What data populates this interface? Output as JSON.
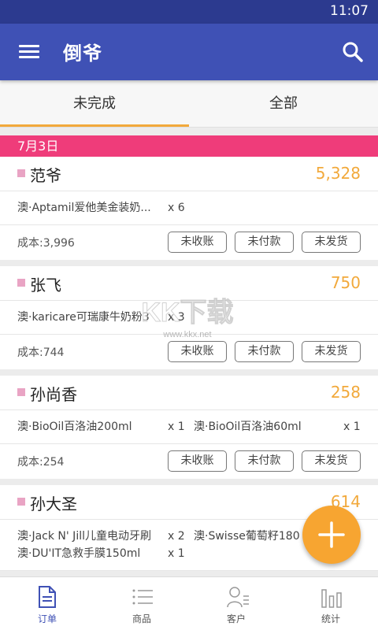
{
  "status_bar": {
    "time": "11:07"
  },
  "app_bar": {
    "title": "倒爷"
  },
  "tabs": [
    {
      "label": "未完成",
      "selected": true
    },
    {
      "label": "全部",
      "selected": false
    }
  ],
  "date_header": "7月3日",
  "orders": [
    {
      "customer": "范爷",
      "amount": "5,328",
      "items": [
        [
          {
            "name": "澳·Aptamil爱他美金装奶...",
            "qty": "x 6"
          }
        ]
      ],
      "cost": "成本:3,996",
      "tags": [
        "未收账",
        "未付款",
        "未发货"
      ]
    },
    {
      "customer": "张飞",
      "amount": "750",
      "items": [
        [
          {
            "name": "澳·karicare可瑞康牛奶粉3",
            "qty": "x 3"
          }
        ]
      ],
      "cost": "成本:744",
      "tags": [
        "未收账",
        "未付款",
        "未发货"
      ]
    },
    {
      "customer": "孙尚香",
      "amount": "258",
      "items": [
        [
          {
            "name": "澳·BioOil百洛油200ml",
            "qty": "x 1"
          },
          {
            "name": "澳·BioOil百洛油60ml",
            "qty": "x 1"
          }
        ]
      ],
      "cost": "成本:254",
      "tags": [
        "未收账",
        "未付款",
        "未发货"
      ]
    },
    {
      "customer": "孙大圣",
      "amount": "614",
      "items": [
        [
          {
            "name": "澳·Jack N' Jill儿童电动牙刷",
            "qty": "x 2"
          },
          {
            "name": "澳·Swisse葡萄籽180",
            "qty": ""
          }
        ],
        [
          {
            "name": "澳·DU'IT急救手膜150ml",
            "qty": "x 1"
          }
        ]
      ],
      "cost": "",
      "tags": []
    }
  ],
  "watermark": {
    "text": "KK下载",
    "url": "www.kkx.net"
  },
  "bottom_nav": [
    {
      "label": "订单",
      "icon": "document-icon",
      "active": true
    },
    {
      "label": "商品",
      "icon": "list-icon",
      "active": false
    },
    {
      "label": "客户",
      "icon": "person-list-icon",
      "active": false
    },
    {
      "label": "统计",
      "icon": "bar-chart-icon",
      "active": false
    }
  ],
  "colors": {
    "status_bar": "#2c3a8f",
    "app_bar": "#3f51b5",
    "accent": "#f2a93b",
    "date_bar": "#ef3c7a",
    "fab": "#f7a531"
  }
}
